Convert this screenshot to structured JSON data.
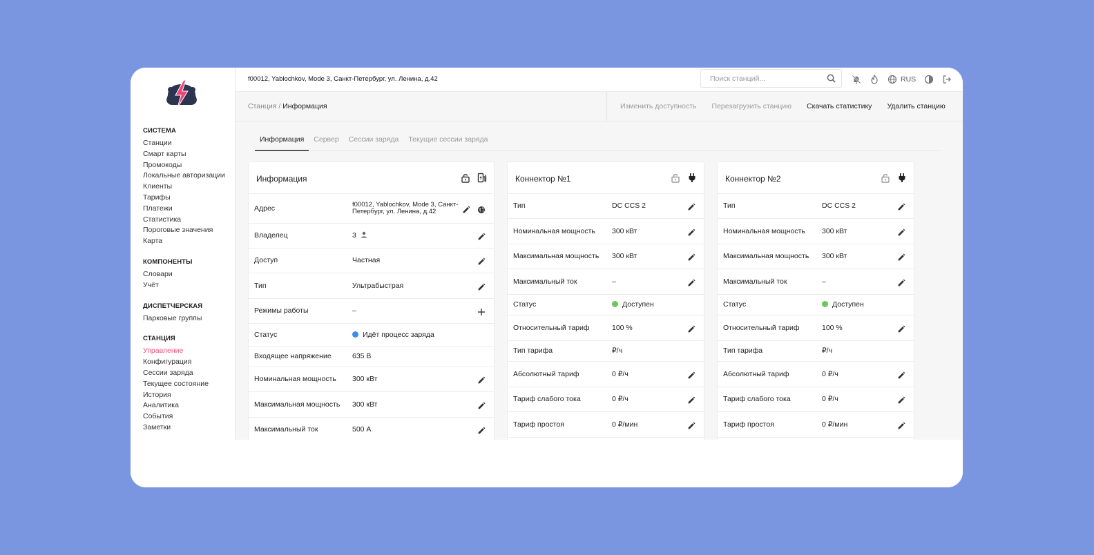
{
  "sidebar": {
    "groups": [
      {
        "title": "СИСТЕМА",
        "items": [
          "Станции",
          "Смарт карты",
          "Промокоды",
          "Локальные авторизации",
          "Клиенты",
          "Тарифы",
          "Платежи",
          "Статистика",
          "Пороговые значения",
          "Карта"
        ]
      },
      {
        "title": "КОМПОНЕНТЫ",
        "items": [
          "Словари",
          "Учёт"
        ]
      },
      {
        "title": "ДИСПЕТЧЕРСКАЯ",
        "items": [
          "Парковые группы"
        ]
      },
      {
        "title": "СТАНЦИЯ",
        "items": [
          "Управление",
          "Конфигурация",
          "Сессии заряда",
          "Текущее состояние",
          "История",
          "Аналитика",
          "События",
          "Заметки"
        ],
        "active": "Управление"
      }
    ],
    "accent": "#e8517a"
  },
  "topbar": {
    "station": "f00012, Yablochkov, Mode 3, Санкт-Петербург, ул. Ленина, д.42",
    "search_placeholder": "Поиск станций...",
    "lang": "RUS"
  },
  "actionbar": {
    "breadcrumb_root": "Станция",
    "breadcrumb_sep": " / ",
    "breadcrumb_current": "Информация",
    "actions": [
      {
        "label": "Изменить доступность",
        "enabled": false
      },
      {
        "label": "Перезагрузить станцию",
        "enabled": false
      },
      {
        "label": "Скачать статистику",
        "enabled": true
      },
      {
        "label": "Удалить станцию",
        "enabled": true
      }
    ]
  },
  "tabs": [
    {
      "label": "Информация",
      "active": true
    },
    {
      "label": "Сервер",
      "active": false
    },
    {
      "label": "Сессии заряда",
      "active": false
    },
    {
      "label": "Текущие сессии заряда",
      "active": false
    }
  ],
  "info_card": {
    "title": "Информация",
    "rows": [
      {
        "label": "Адрес",
        "value": "f00012, Yablochkov, Mode 3, Санкт-Петербург, ул. Ленина, д.42",
        "action": "edit",
        "globe": true
      },
      {
        "label": "Владелец",
        "value": "3",
        "action": "edit",
        "person": true
      },
      {
        "label": "Доступ",
        "value": "Частная",
        "action": "edit"
      },
      {
        "label": "Тип",
        "value": "Ультрабыстрая",
        "action": "edit"
      },
      {
        "label": "Режимы работы",
        "value": "–",
        "action": "add"
      },
      {
        "label": "Статус",
        "value": "Идёт процесс заряда",
        "action": "none",
        "dot": "#3b8ee8"
      },
      {
        "label": "Входящее напряжение",
        "value": "635 В",
        "action": "none"
      },
      {
        "label": "Номинальная мощность",
        "value": "300 кВт",
        "action": "edit"
      },
      {
        "label": "Максимальная мощность",
        "value": "300 кВт",
        "action": "edit"
      },
      {
        "label": "Максимальный ток",
        "value": "500 А",
        "action": "edit"
      }
    ]
  },
  "connectors": [
    {
      "title": "Коннектор №1",
      "rows": [
        {
          "label": "Тип",
          "value": "DC CCS 2",
          "action": "edit"
        },
        {
          "label": "Номинальная мощность",
          "value": "300 кВт",
          "action": "edit"
        },
        {
          "label": "Максимальная мощность",
          "value": "300 кВт",
          "action": "edit"
        },
        {
          "label": "Максимальный ток",
          "value": "–",
          "action": "edit"
        },
        {
          "label": "Статус",
          "value": "Доступен",
          "action": "none",
          "dot": "#6cc65a"
        },
        {
          "label": "Относительный тариф",
          "value": "100 %",
          "action": "edit"
        },
        {
          "label": "Тип тарифа",
          "value": "₽/ч",
          "action": "none"
        },
        {
          "label": "Абсолютный тариф",
          "value": "0 ₽/ч",
          "action": "edit"
        },
        {
          "label": "Тариф слабого тока",
          "value": "0 ₽/ч",
          "action": "edit"
        },
        {
          "label": "Тариф простоя",
          "value": "0 ₽/мин",
          "action": "edit"
        }
      ]
    },
    {
      "title": "Коннектор №2",
      "rows": [
        {
          "label": "Тип",
          "value": "DC CCS 2",
          "action": "edit"
        },
        {
          "label": "Номинальная мощность",
          "value": "300 кВт",
          "action": "edit"
        },
        {
          "label": "Максимальная мощность",
          "value": "300 кВт",
          "action": "edit"
        },
        {
          "label": "Максимальный ток",
          "value": "–",
          "action": "edit"
        },
        {
          "label": "Статус",
          "value": "Доступен",
          "action": "none",
          "dot": "#6cc65a"
        },
        {
          "label": "Относительный тариф",
          "value": "100 %",
          "action": "edit"
        },
        {
          "label": "Тип тарифа",
          "value": "₽/ч",
          "action": "none"
        },
        {
          "label": "Абсолютный тариф",
          "value": "0 ₽/ч",
          "action": "edit"
        },
        {
          "label": "Тариф слабого тока",
          "value": "0 ₽/ч",
          "action": "edit"
        },
        {
          "label": "Тариф простоя",
          "value": "0 ₽/мин",
          "action": "edit"
        }
      ]
    }
  ]
}
